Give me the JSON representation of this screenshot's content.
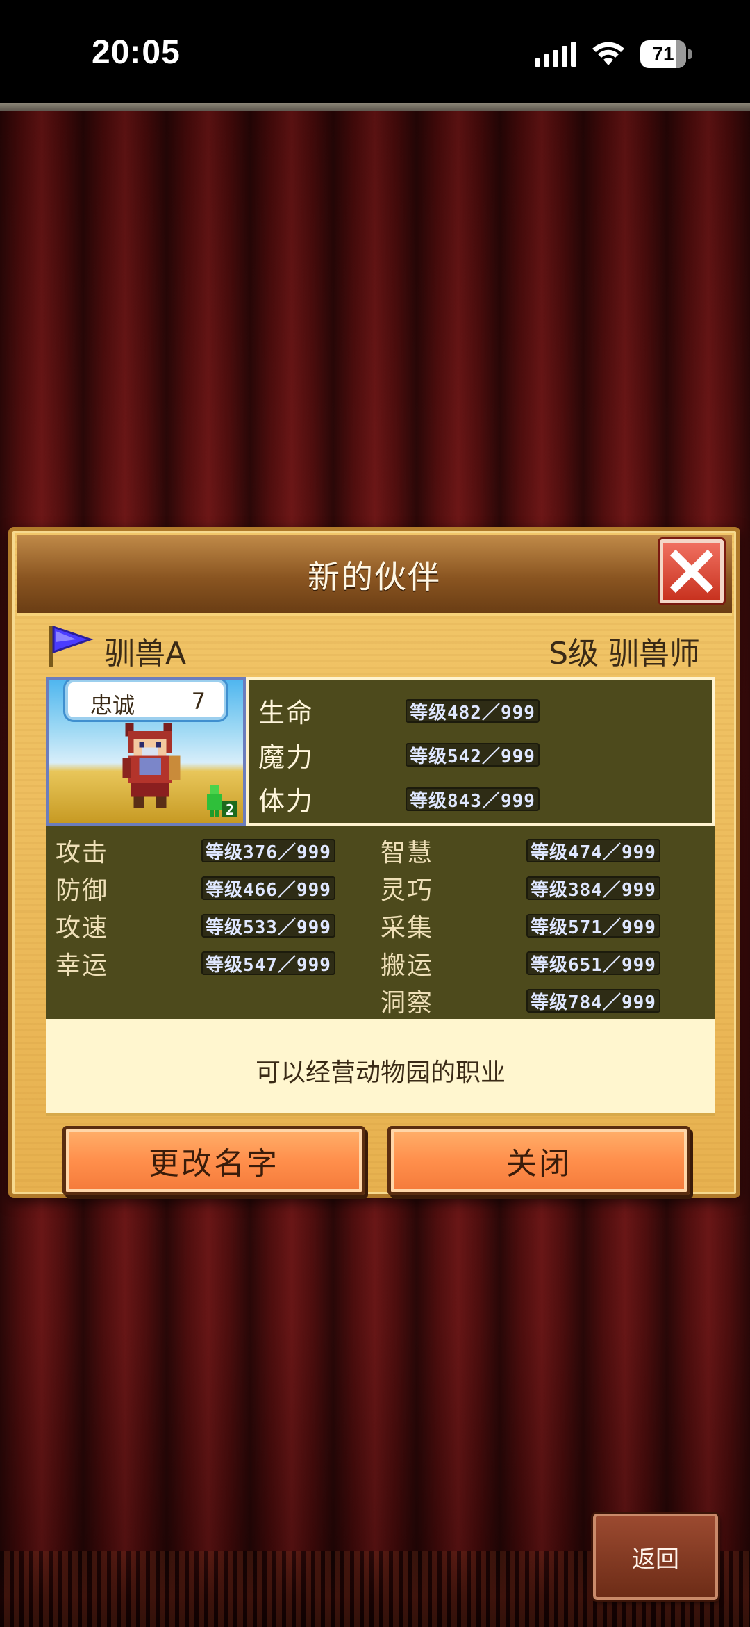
{
  "status_bar": {
    "time": "20:05",
    "battery": "71",
    "icons": [
      "signal-icon",
      "wifi-icon",
      "battery-icon"
    ]
  },
  "dialog": {
    "title": "新的伙伴",
    "close_icon": "close-icon",
    "character": {
      "name": "驯兽A",
      "class": "S级 驯兽师",
      "flag_icon": "flag-icon"
    },
    "portrait": {
      "loyalty_label": "忠诚",
      "loyalty_value": "7",
      "party_badge": "2"
    },
    "top_stats": [
      {
        "label": "生命",
        "value": "等级482／999"
      },
      {
        "label": "魔力",
        "value": "等级542／999"
      },
      {
        "label": "体力",
        "value": "等级843／999"
      }
    ],
    "left_stats": [
      {
        "label": "攻击",
        "value": "等级376／999"
      },
      {
        "label": "防御",
        "value": "等级466／999"
      },
      {
        "label": "攻速",
        "value": "等级533／999"
      },
      {
        "label": "幸运",
        "value": "等级547／999"
      }
    ],
    "right_stats": [
      {
        "label": "智慧",
        "value": "等级474／999"
      },
      {
        "label": "灵巧",
        "value": "等级384／999"
      },
      {
        "label": "采集",
        "value": "等级571／999"
      },
      {
        "label": "搬运",
        "value": "等级651／999"
      },
      {
        "label": "洞察",
        "value": "等级784／999"
      }
    ],
    "description": "可以经营动物园的职业",
    "rename_button": "更改名字",
    "close_button": "关闭"
  },
  "back_button": "返回",
  "colors": {
    "dialog_bg": "#e7b14f",
    "header": "#8a5521",
    "stats_panel": "#4d4a1c",
    "button": "#ff8f4c",
    "curtain": "#6b1414"
  }
}
